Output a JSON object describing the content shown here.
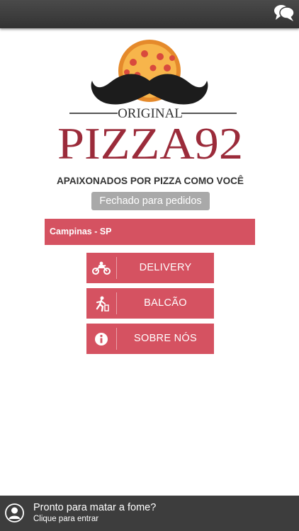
{
  "header": {
    "chat_icon": "chat-bubbles-icon"
  },
  "logo": {
    "tag": "ORIGINAL",
    "name": "PIZZA92",
    "slogan": "APAIXONADOS POR PIZZA COMO VOCÊ",
    "colors": {
      "brand_red": "#9b2b3a",
      "mustache": "#1c1c1c",
      "pizza": "#f3a53b"
    }
  },
  "store_status": "Fechado para pedidos",
  "city": "Campinas - SP",
  "menu": [
    {
      "label": "DELIVERY",
      "icon": "motorcycle-icon"
    },
    {
      "label": "BALCÃO",
      "icon": "running-person-icon"
    },
    {
      "label": "SOBRE NÓS",
      "icon": "info-icon"
    }
  ],
  "footer": {
    "title": "Pronto para matar a fome?",
    "subtitle": "Clique para entrar",
    "icon": "user-avatar-icon"
  },
  "colors": {
    "accent": "#d55261",
    "topbar": "#3a3a3a",
    "status_pill": "#a9a9a9"
  }
}
